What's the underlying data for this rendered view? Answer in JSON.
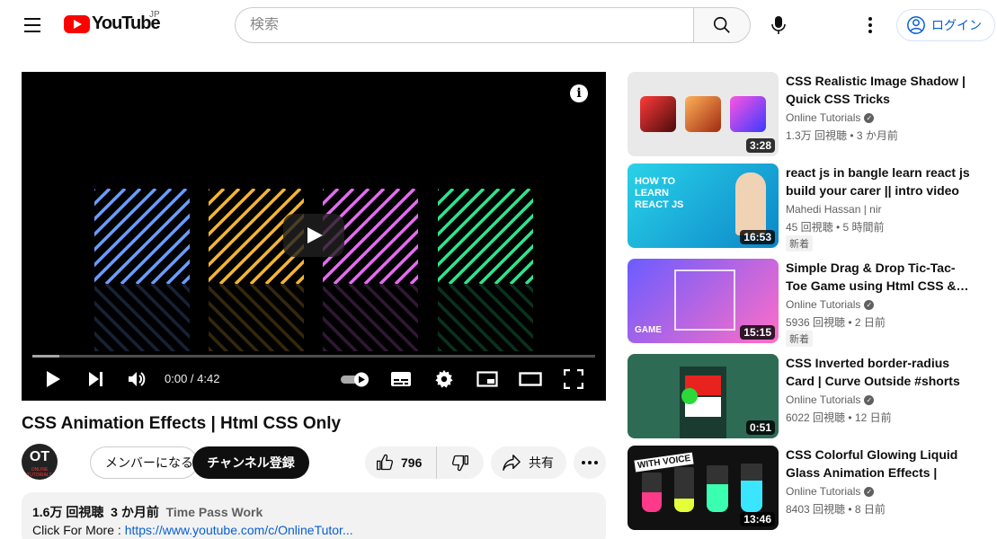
{
  "header": {
    "logo_text": "YouTube",
    "country": "JP",
    "search_placeholder": "検索",
    "login_label": "ログイン"
  },
  "player": {
    "time": "0:00 / 4:42",
    "progress_fraction": 0.0,
    "stripe_colors": [
      "#6a9cff",
      "#f4b534",
      "#e36cf0",
      "#2ee58a"
    ]
  },
  "video": {
    "title": "CSS Animation Effects | Html CSS Only",
    "channel_avatar_text": "OT",
    "channel_avatar_sub": "ONLINE TUTORIALS",
    "member_label": "メンバーになる",
    "subscribe_label": "チャンネル登録",
    "likes": "796",
    "share_label": "共有"
  },
  "description": {
    "views": "1.6万 回視聴",
    "age": "3 か月前",
    "tag": "Time Pass Work",
    "line2_prefix": "Click For More : ",
    "link": "https://www.youtube.com/c/OnlineTutor..."
  },
  "recommendations": [
    {
      "title": "CSS Realistic Image Shadow | Quick CSS Tricks",
      "channel": "Online Tutorials",
      "verified": true,
      "views": "1.3万 回視聴",
      "age": "3 か月前",
      "duration": "3:28",
      "badge": ""
    },
    {
      "title": "react js in bangle learn react js build your carer || intro video",
      "channel": "Mahedi Hassan | nir",
      "verified": false,
      "views": "45 回視聴",
      "age": "5 時間前",
      "duration": "16:53",
      "badge": "新着",
      "thumb_text": "HOW TO LEARN REACT JS"
    },
    {
      "title": "Simple Drag & Drop Tic-Tac-Toe Game using Html CSS &…",
      "channel": "Online Tutorials",
      "verified": true,
      "views": "5936 回視聴",
      "age": "2 日前",
      "duration": "15:15",
      "badge": "新着",
      "thumb_text": "GAME"
    },
    {
      "title": "CSS Inverted border-radius Card | Curve Outside #shorts",
      "channel": "Online Tutorials",
      "verified": true,
      "views": "6022 回視聴",
      "age": "12 日前",
      "duration": "0:51",
      "badge": ""
    },
    {
      "title": "CSS Colorful Glowing Liquid Glass Animation Effects | Html…",
      "channel": "Online Tutorials",
      "verified": true,
      "views": "8403 回視聴",
      "age": "8 日前",
      "duration": "13:46",
      "badge": "",
      "thumb_text": "WITH VOICE"
    }
  ]
}
